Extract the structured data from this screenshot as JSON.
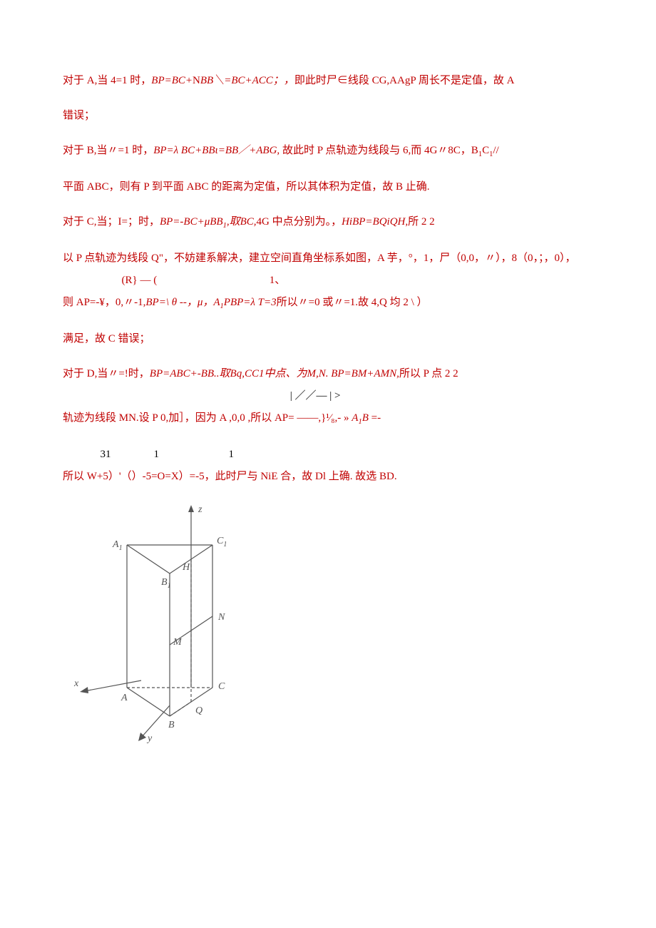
{
  "p1": {
    "a": "对于 A,当 4=1 时，",
    "b": "BP=BC+",
    "c": "N",
    "d": "BB",
    "e": "＼=",
    "f": "BC",
    "g": "+ACC；，",
    "h": "即此时尸∈线段 CG,AAgP 周长不是定值，故 A"
  },
  "p2": "错误；",
  "p3": {
    "a": "对于 B,当〃=1 时，",
    "b": "BP=λ BC+BBι=BB／+ABG,",
    "c": " 故此时 P 点轨迹为线段与 6,而 4G〃8C，B",
    "d": "1",
    "e": "C",
    "f": "1",
    "g": "//"
  },
  "p4": "平面 ABC，则有 P 到平面 ABC 的距离为定值，所以其体积为定值，故 B 止确.",
  "p5": {
    "a": "对于 C,当；I=；时，",
    "b": "BP=-BC+μBB",
    "c": "1",
    "d": ",",
    "e": "取BC,",
    "f": "4G 中点分别为。，",
    "g": "HiBP=BQiQH,",
    "h": "所 2        2"
  },
  "p6": {
    "a": "以 P 点轨迹为线段 Q\"，不妨建系解决，建立空间直角坐标系如图，A 芋，°，1，尸（0,0，〃），8（0，；，0），"
  },
  "p7": {
    "top": "                      (R} — (                                          1、",
    "mid_a": "则 AP=-¥，0,〃-1,",
    "mid_b": "BP=\\ θ --，μ，A",
    "mid_b1": "1",
    "mid_c": "PBP=λ T=3",
    "mid_d": "所以〃=0 或〃=1.故 4,Q 均 2             \\             ）"
  },
  "p8": "满足，故 C 错误；",
  "p9": {
    "a": "对于 D,当〃=!时，",
    "b": "BP=ABC+-BB..",
    "c": "取Bq,CC1中点、为M,N. BP=BM+AMN,",
    "d": "所以 P 点 2 2"
  },
  "p10": "                                                                                     | ／／— | >",
  "p11": {
    "a": "轨迹为线段 MN.设 P 0,加］，因为 A                               ,0,0 ,所以 AP= ——,}¹⁄₈,- » ",
    "b": "A",
    "c": "1",
    "d": "B",
    "e": " =-"
  },
  "p12": {
    "top": "              31                1                          1",
    "a": " 所以 W+5）'（）-5=O=X）=-5，此时尸与 NiE 合，故 Dl 上确. 故选 BD."
  },
  "diagram": {
    "labels": {
      "z": "z",
      "x": "x",
      "y": "y",
      "A1": "A",
      "A1s": "1",
      "B1": "B",
      "B1s": "1",
      "C1": "C",
      "C1s": "1",
      "H": "H",
      "N": "N",
      "M": "M",
      "A": "A",
      "B": "B",
      "C": "C",
      "Q": "Q"
    }
  }
}
